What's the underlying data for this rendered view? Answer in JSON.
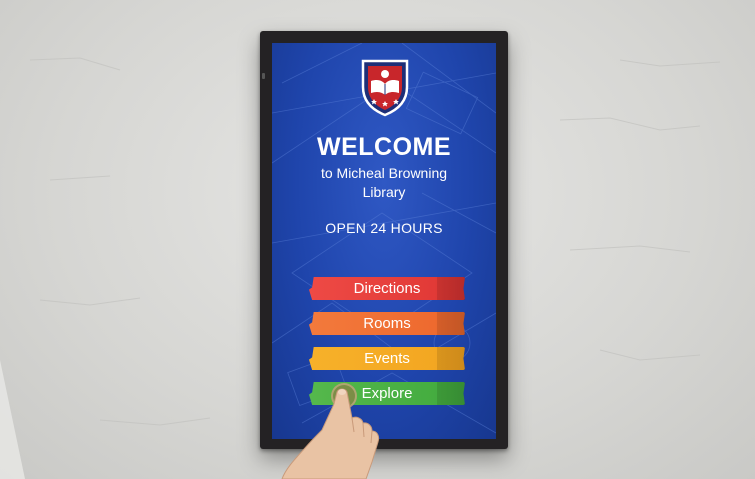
{
  "kiosk": {
    "welcome": "WELCOME",
    "subtitle_line1": "to Micheal Browning",
    "subtitle_line2": "Library",
    "hours": "OPEN 24 HOURS",
    "crest_icon": "library-crest-icon",
    "menu": [
      {
        "label": "Directions",
        "color": "#e23a37"
      },
      {
        "label": "Rooms",
        "color": "#ee6a2f"
      },
      {
        "label": "Events",
        "color": "#f3a722"
      },
      {
        "label": "Explore",
        "color": "#45ad40"
      }
    ]
  },
  "colors": {
    "screen_bg": "#1f45ac",
    "bezel": "#242224",
    "wall": "#d9d9d7"
  }
}
